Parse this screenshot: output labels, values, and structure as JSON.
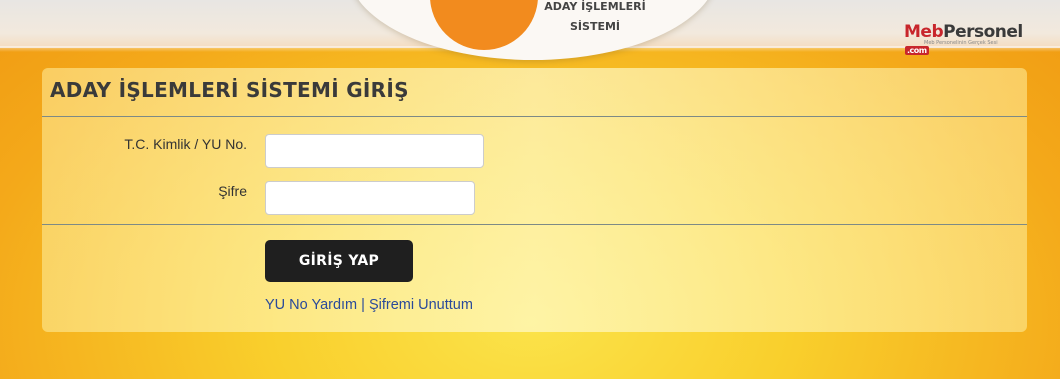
{
  "header": {
    "logo_text_line1": "ADAY İŞLEMLERİ",
    "logo_text_line2": "SİSTEMİ",
    "brand_meb": "Meb",
    "brand_personel": "Personel",
    "brand_com": ".com",
    "brand_tagline": "Meb Personelinin Gerçek Sesi",
    "colors": {
      "accent": "#f28b1e",
      "brand_red": "#c8262c"
    }
  },
  "login": {
    "title": "ADAY İŞLEMLERİ SİSTEMİ GİRİŞ",
    "id_label": "T.C. Kimlik / YU No.",
    "id_value": "",
    "password_label": "Şifre",
    "password_value": "",
    "submit_label": "GİRİŞ YAP",
    "help_link": "YU No Yardım",
    "separator": "|",
    "forgot_link": "Şifremi Unuttum"
  }
}
